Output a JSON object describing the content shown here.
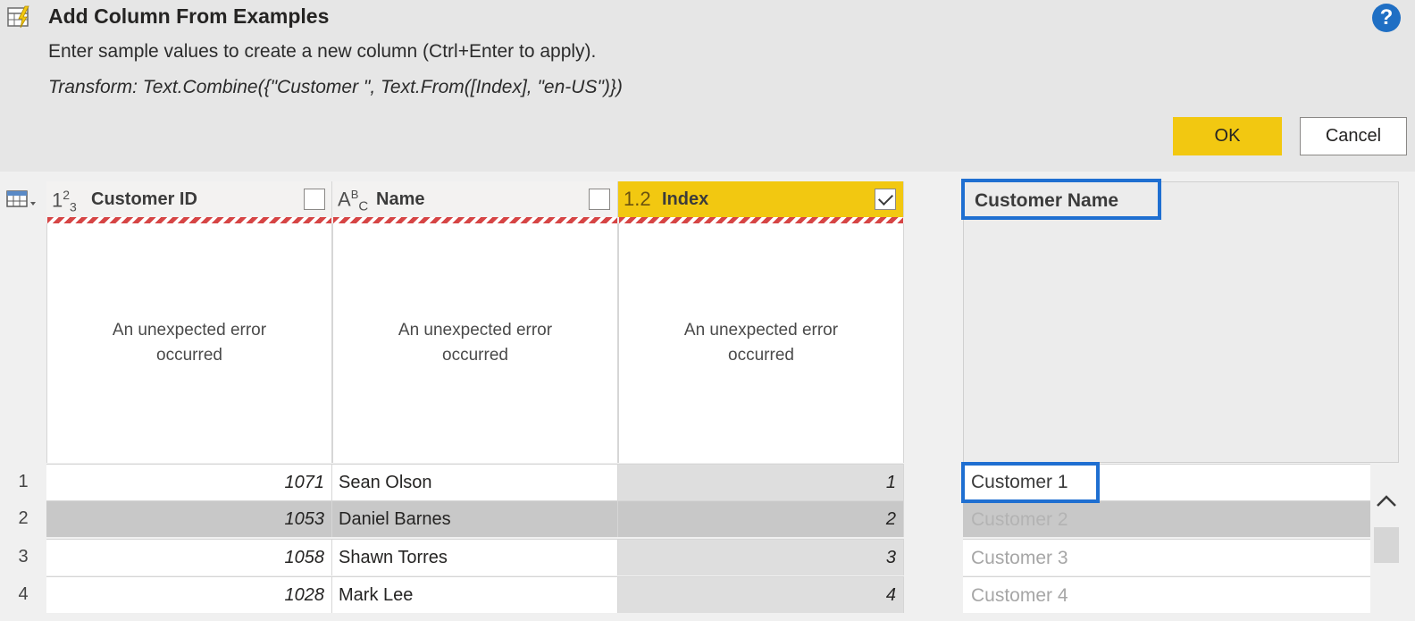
{
  "dialog": {
    "title": "Add Column From Examples",
    "subtitle": "Enter sample values to create a new column (Ctrl+Enter to apply).",
    "transform": "Transform: Text.Combine({\"Customer \", Text.From([Index], \"en-US\")})",
    "help_label": "?",
    "ok_label": "OK",
    "cancel_label": "Cancel",
    "accent_color": "#f2c811",
    "selection_color": "#1f6fd1"
  },
  "columns": [
    {
      "type_icon": "1²3",
      "type_icon_name": "whole-number-type-icon",
      "name": "Customer ID",
      "checked": false
    },
    {
      "type_icon": "ABC",
      "type_icon_name": "text-type-icon",
      "name": "Name",
      "checked": false
    },
    {
      "type_icon": "1.2",
      "type_icon_name": "decimal-type-icon",
      "name": "Index",
      "checked": true
    }
  ],
  "error_message": "An unexpected error occurred",
  "rows": [
    {
      "num": "1",
      "customer_id": "1071",
      "name": "Sean Olson",
      "index": "1"
    },
    {
      "num": "2",
      "customer_id": "1053",
      "name": "Daniel Barnes",
      "index": "2"
    },
    {
      "num": "3",
      "customer_id": "1058",
      "name": "Shawn Torres",
      "index": "3"
    },
    {
      "num": "4",
      "customer_id": "1028",
      "name": "Mark Lee",
      "index": "4"
    }
  ],
  "new_column": {
    "header": "Customer Name",
    "values": [
      "Customer 1",
      "Customer 2",
      "Customer 3",
      "Customer 4"
    ]
  }
}
